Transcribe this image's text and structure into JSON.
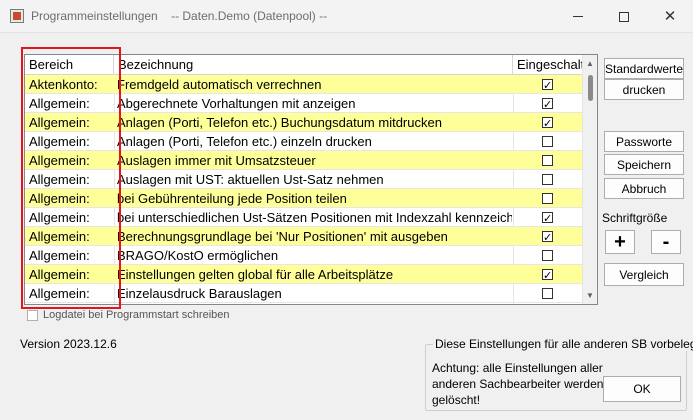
{
  "window": {
    "title": "Programmeinstellungen    -- Daten.Demo (Datenpool) --"
  },
  "table": {
    "columns": [
      "Bereich",
      "Bezeichnung",
      "Eingeschaltet"
    ],
    "rows": [
      {
        "bereich": "Aktenkonto:",
        "bezeichnung": "Fremdgeld automatisch verrechnen",
        "checked": true
      },
      {
        "bereich": "Allgemein:",
        "bezeichnung": "Abgerechnete Vorhaltungen mit anzeigen",
        "checked": true
      },
      {
        "bereich": "Allgemein:",
        "bezeichnung": "Anlagen (Porti, Telefon etc.) Buchungsdatum mitdrucken",
        "checked": true
      },
      {
        "bereich": "Allgemein:",
        "bezeichnung": "Anlagen (Porti, Telefon etc.) einzeln drucken",
        "checked": false
      },
      {
        "bereich": "Allgemein:",
        "bezeichnung": "Auslagen immer mit Umsatzsteuer",
        "checked": false
      },
      {
        "bereich": "Allgemein:",
        "bezeichnung": "Auslagen mit UST: aktuellen Ust-Satz nehmen",
        "checked": false
      },
      {
        "bereich": "Allgemein:",
        "bezeichnung": "bei Gebührenteilung jede Position teilen",
        "checked": false
      },
      {
        "bereich": "Allgemein:",
        "bezeichnung": "bei unterschiedlichen Ust-Sätzen Positionen mit Indexzahl kennzeichnen",
        "checked": true
      },
      {
        "bereich": "Allgemein:",
        "bezeichnung": "Berechnungsgrundlage bei 'Nur Positionen' mit ausgeben",
        "checked": true
      },
      {
        "bereich": "Allgemein:",
        "bezeichnung": "BRAGO/KostO ermöglichen",
        "checked": false
      },
      {
        "bereich": "Allgemein:",
        "bezeichnung": "Einstellungen gelten global für alle Arbeitsplätze",
        "checked": true
      },
      {
        "bereich": "Allgemein:",
        "bezeichnung": "Einzelausdruck Barauslagen",
        "checked": false
      }
    ]
  },
  "buttons": {
    "standardwerte": "Standardwerte",
    "drucken": "drucken",
    "passworte": "Passworte",
    "speichern": "Speichern",
    "abbruch": "Abbruch",
    "plus": "+",
    "minus": "-",
    "vergleich": "Vergleich",
    "ok": "OK"
  },
  "schriftgroesse_label": "Schriftgröße",
  "logdatei_label": "Logdatei bei Programmstart schreiben",
  "version": "Version 2023.12.6",
  "group": {
    "legend": "Diese Einstellungen für alle anderen SB vorbelegen?",
    "text": "Achtung: alle Einstellungen aller anderen Sachbearbeiter werden gelöscht!"
  },
  "colors": {
    "highlight_row": "#ffff99",
    "annotation_box": "#e2161b"
  }
}
